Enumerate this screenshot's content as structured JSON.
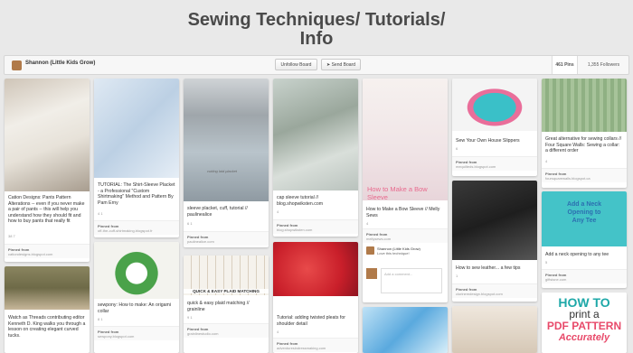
{
  "board": {
    "title_line1": "Sewing Techniques/ Tutorials/",
    "title_line2": "Info"
  },
  "toolbar": {
    "owner": "Shannon (Little Kids Grow)",
    "unfollow": "Unfollow Board",
    "send": "Send Board",
    "pins_count": "461 Pins",
    "followers_count": "1,355 Followers"
  },
  "pins": {
    "p1": {
      "desc": "Cation Designs: Pants Pattern Alterations -- even if you never make a pair of pants -- this will help you understand how they should fit and how to buy pants that really fit",
      "meta": "38  7",
      "from": "Pinned from",
      "domain": "cationdesigns.blogspot.com"
    },
    "p2": {
      "desc": "Watch as Threads contributing editor Kenneth D. King walks you through a lesson on creating elegant curved tucks."
    },
    "p3": {
      "desc": "TUTORIAL: The Shirt-Sleeve Placket - a Professional \"Custom Shirtmaking\" Method and Pattern By Pam Erny",
      "meta": "4  1",
      "from": "Pinned from",
      "domain": "off-the-cuff-shirtmaking.blogspot.fr"
    },
    "p4": {
      "desc": "sewpony: How to make: An origami collar",
      "meta": "8  1",
      "from": "Pinned from",
      "domain": "sewpony.blogspot.com"
    },
    "p5": {
      "desc": "sleeve placket, cuff, tutorial // paulinealice",
      "meta": "6  1",
      "from": "Pinned from",
      "domain": "paulinealice.com",
      "overlay": "cutting laid placket"
    },
    "p6": {
      "desc": "quick & easy plaid matching // grainline",
      "meta": "9  1",
      "from": "Pinned from",
      "domain": "grainlinestudio.com",
      "banner": "QUICK & EASY PLAID MATCHING"
    },
    "p7": {
      "desc": "cap sleeve tutorial // blog.shopwiksten.com",
      "meta": "4",
      "from": "Pinned from",
      "domain": "blog.shopwiksten.com"
    },
    "p8": {
      "desc": "Tutorial: adding twisted pleats for shoulder detail",
      "meta": "4",
      "from": "Pinned from",
      "domain": "adventuresindressmaking.com"
    },
    "p9": {
      "desc": "How to Make a Bow Sleeve // Melly Sews",
      "meta": "4",
      "from": "Pinned from",
      "domain": "mellysews.com",
      "overlay": "How to Make a Bow Sleeve",
      "comment_user": "Shannon (Little Kids Grow)",
      "comment_text": "Love this technique!",
      "comment_placeholder": "Add a comment..."
    },
    "p10": {
      "desc": "Sew Your Own House Slippers",
      "meta": "6",
      "from": "Pinned from",
      "domain": "mequilteds.blogspot.com"
    },
    "p11": {
      "desc": "How to sew leather... a few tips",
      "meta": "1",
      "from": "Pinned from",
      "domain": "clorinemdesign.blogspot.com"
    },
    "p12": {
      "desc": "Great alternative for sewing collars // Four Square Walls: Sewing a collar: a different order",
      "meta": "4",
      "from": "Pinned from",
      "domain": "foursquarewalls.blogspot.ca"
    },
    "p13": {
      "desc": "Add a neck opening to any tee",
      "meta": "5",
      "from": "Pinned from",
      "domain": "giftsisne.com",
      "overlay1": "Add a Neck",
      "overlay2": "Opening to",
      "overlay3": "Any Tee"
    },
    "p14": {
      "line1": "HOW TO",
      "line2": "print a",
      "line3": "PDF PATTERN",
      "line4": "Accurately"
    }
  },
  "colors": {
    "bow_pink": "#e86a8e",
    "tee_blue": "#2c6fb0",
    "teal_title": "#1ea8a8"
  }
}
